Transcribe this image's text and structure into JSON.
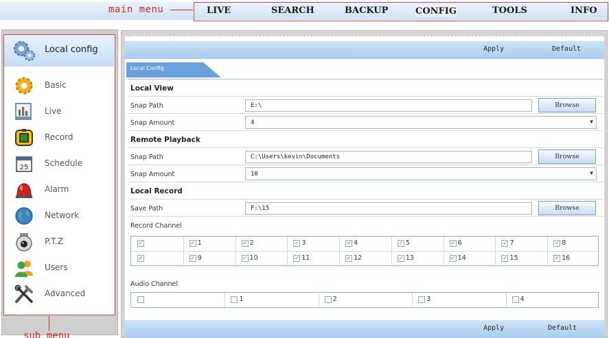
{
  "annotations": {
    "main_menu": "main menu",
    "sub_menu": "sub menu"
  },
  "main_menu": [
    {
      "label": "LIVE"
    },
    {
      "label": "SEARCH"
    },
    {
      "label": "BACKUP"
    },
    {
      "label": "CONFIG",
      "active": true
    },
    {
      "label": "TOOLS"
    },
    {
      "label": "INFO"
    }
  ],
  "sidebar": {
    "header": {
      "label": "Local config",
      "icon": "gears-icon"
    },
    "items": [
      {
        "label": "Basic",
        "icon": "gear-icon"
      },
      {
        "label": "Live",
        "icon": "live-chart-icon"
      },
      {
        "label": "Record",
        "icon": "record-icon"
      },
      {
        "label": "Schedule",
        "icon": "calendar-icon",
        "day": "25"
      },
      {
        "label": "Alarm",
        "icon": "alarm-icon"
      },
      {
        "label": "Network",
        "icon": "globe-icon"
      },
      {
        "label": "P.T.Z",
        "icon": "ptz-camera-icon"
      },
      {
        "label": "Users",
        "icon": "users-icon"
      },
      {
        "label": "Advanced",
        "icon": "tools-icon"
      }
    ]
  },
  "toolbar": {
    "apply_label": "Apply",
    "default_label": "Default"
  },
  "tab": {
    "label": "Local Config"
  },
  "local_view": {
    "title": "Local View",
    "snap_path_label": "Snap Path",
    "snap_path_value": "E:\\",
    "snap_amount_label": "Snap Amount",
    "snap_amount_value": "4",
    "browse_label": "Browse"
  },
  "remote_playback": {
    "title": "Remote Playback",
    "snap_path_label": "Snap Path",
    "snap_path_value": "C:\\Users\\kevin\\Documents",
    "snap_amount_label": "Snap Amount",
    "snap_amount_value": "10",
    "browse_label": "Browse"
  },
  "local_record": {
    "title": "Local Record",
    "save_path_label": "Save Path",
    "save_path_value": "F:\\15",
    "browse_label": "Browse",
    "record_channel_label": "Record Channel",
    "record_channels": [
      [
        "",
        "1",
        "2",
        "3",
        "4",
        "5",
        "6",
        "7",
        "8"
      ],
      [
        "",
        "9",
        "10",
        "11",
        "12",
        "13",
        "14",
        "15",
        "16"
      ]
    ],
    "record_checked": true,
    "audio_channel_label": "Audio Channel",
    "audio_channels": [
      "",
      "1",
      "2",
      "3",
      "4"
    ],
    "audio_checked": false
  },
  "colors": {
    "accent": "#3f86d4",
    "annotation": "#d12a2a",
    "header_gradient": "#c4dcf3"
  }
}
